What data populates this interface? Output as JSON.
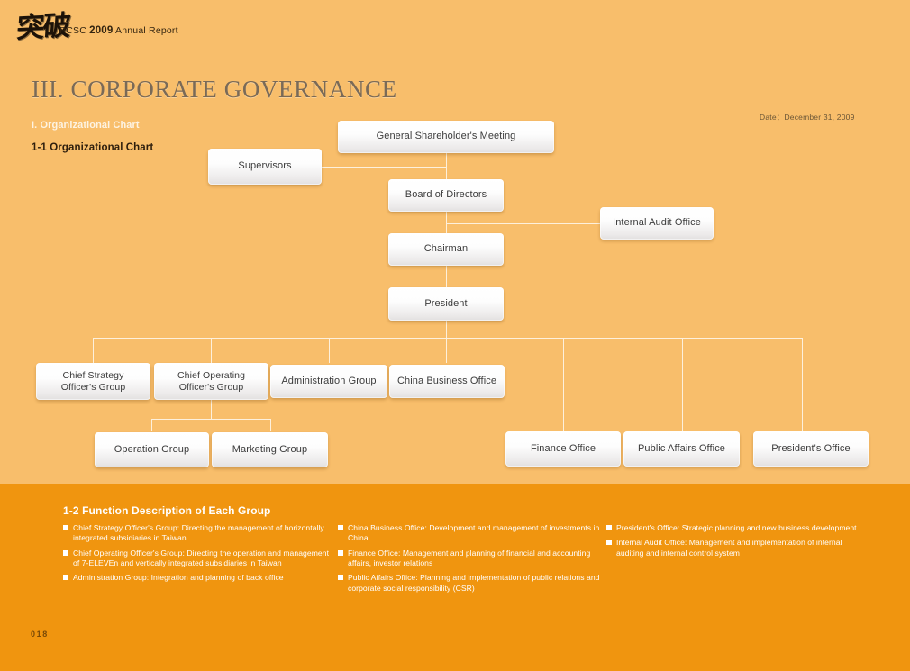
{
  "colors": {
    "background": "#f8be6b",
    "panel": "#f0950f",
    "line": "#fdf0dc",
    "title_text": "#7a6a57",
    "node_text": "#3b3b3b",
    "panel_text": "#ffffff"
  },
  "header": {
    "logo_mark": "突破",
    "brand_prefix": "PCSC ",
    "brand_year": "2009",
    "brand_suffix": " Annual Report",
    "title": "III. CORPORATE GOVERNANCE",
    "section_label": "I. Organizational Chart",
    "sub_label": "1-1 Organizational Chart",
    "date": "Date：December 31, 2009"
  },
  "chart_data": {
    "type": "diagram",
    "title": "1-1 Organizational Chart",
    "nodes": [
      {
        "id": "shareholders",
        "label": "General Shareholder's Meeting"
      },
      {
        "id": "supervisors",
        "label": "Supervisors"
      },
      {
        "id": "board",
        "label": "Board of Directors"
      },
      {
        "id": "audit",
        "label": "Internal Audit Office"
      },
      {
        "id": "chairman",
        "label": "Chairman"
      },
      {
        "id": "president",
        "label": "President"
      },
      {
        "id": "cso",
        "label": "Chief Strategy Officer's Group"
      },
      {
        "id": "coo",
        "label": "Chief Operating Officer's Group"
      },
      {
        "id": "admin",
        "label": "Administration Group"
      },
      {
        "id": "china",
        "label": "China Business Office"
      },
      {
        "id": "operation",
        "label": "Operation Group"
      },
      {
        "id": "marketing",
        "label": "Marketing Group"
      },
      {
        "id": "finance",
        "label": "Finance Office"
      },
      {
        "id": "publicaffairs",
        "label": "Public Affairs Office"
      },
      {
        "id": "presidentoffice",
        "label": "President's Office"
      }
    ],
    "edges": [
      {
        "from": "shareholders",
        "to": "supervisors"
      },
      {
        "from": "shareholders",
        "to": "board"
      },
      {
        "from": "board",
        "to": "audit"
      },
      {
        "from": "board",
        "to": "chairman"
      },
      {
        "from": "chairman",
        "to": "president"
      },
      {
        "from": "president",
        "to": "cso"
      },
      {
        "from": "president",
        "to": "coo"
      },
      {
        "from": "president",
        "to": "admin"
      },
      {
        "from": "president",
        "to": "china"
      },
      {
        "from": "president",
        "to": "finance"
      },
      {
        "from": "president",
        "to": "publicaffairs"
      },
      {
        "from": "president",
        "to": "presidentoffice"
      },
      {
        "from": "coo",
        "to": "operation"
      },
      {
        "from": "coo",
        "to": "marketing"
      }
    ]
  },
  "nodes": {
    "shareholders": "General Shareholder's Meeting",
    "supervisors": "Supervisors",
    "board": "Board of Directors",
    "audit": "Internal Audit Office",
    "chairman": "Chairman",
    "president": "President",
    "cso_l1": "Chief Strategy",
    "cso_l2": "Officer's Group",
    "coo_l1": "Chief Operating",
    "coo_l2": "Officer's Group",
    "admin": "Administration Group",
    "china": "China Business Office",
    "operation": "Operation Group",
    "marketing": "Marketing Group",
    "finance": "Finance Office",
    "publicaffairs": "Public Affairs Office",
    "presidentoffice": "President's Office"
  },
  "panel": {
    "title": "1-2 Function Description of Each Group",
    "columns": [
      [
        "Chief Strategy Officer's Group: Directing the management of horizontally integrated subsidiaries in Taiwan",
        "Chief Operating Officer's Group: Directing the operation and management of 7-ELEVEn and vertically integrated subsidiaries in Taiwan",
        "Administration Group: Integration and planning of back office"
      ],
      [
        "China Business Office: Development and management of investments in China",
        "Finance Office: Management and planning of financial and accounting affairs, investor relations",
        "Public Affairs Office: Planning and implementation of public relations and corporate social responsibility (CSR)"
      ],
      [
        "President's Office: Strategic planning and new business development",
        "Internal Audit Office: Management and implementation of internal auditing and internal control system"
      ]
    ]
  },
  "footer": {
    "page_number": "018"
  }
}
